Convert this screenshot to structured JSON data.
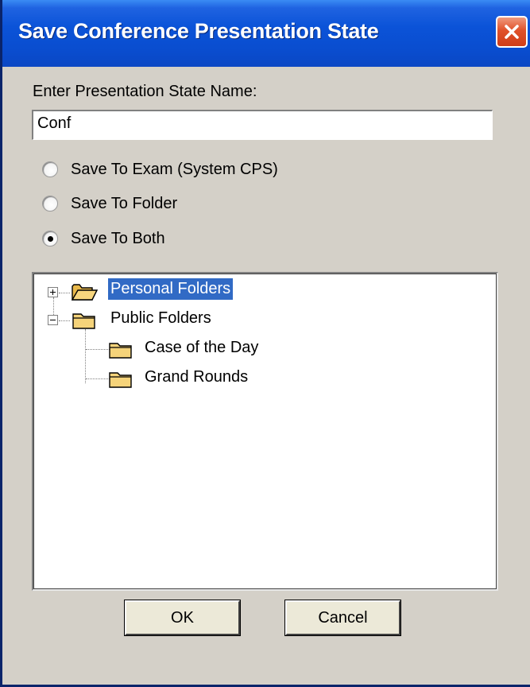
{
  "window": {
    "title": "Save Conference Presentation State"
  },
  "form": {
    "name_label": "Enter Presentation State Name:",
    "name_value": "Conf"
  },
  "save_options": [
    {
      "label": "Save To Exam  (System CPS)",
      "selected": false
    },
    {
      "label": "Save To Folder",
      "selected": false
    },
    {
      "label": "Save To Both",
      "selected": true
    }
  ],
  "tree": {
    "nodes": [
      {
        "label": "Personal Folders",
        "expanded": false,
        "selected": true,
        "icon": "folder-open-icon"
      },
      {
        "label": "Public Folders",
        "expanded": true,
        "selected": false,
        "icon": "folder-icon",
        "children": [
          {
            "label": "Case of the Day",
            "icon": "folder-icon"
          },
          {
            "label": "Grand Rounds",
            "icon": "folder-icon"
          }
        ]
      }
    ]
  },
  "buttons": {
    "ok_label": "OK",
    "cancel_label": "Cancel"
  },
  "colors": {
    "titlebar": "#0b53d8",
    "selection": "#316ac5",
    "dialog_bg": "#d4d0c8",
    "close_button": "#e0512a",
    "folder": "#f5d37a"
  }
}
